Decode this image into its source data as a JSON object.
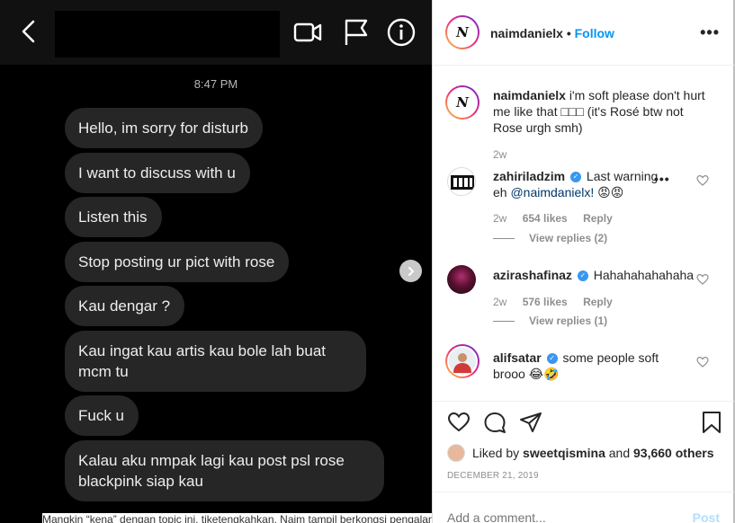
{
  "dm": {
    "time": "8:47 PM",
    "messages": [
      "Hello, im sorry for disturb",
      "I want to discuss with u",
      "Listen this",
      "Stop posting ur pict with rose",
      "Kau dengar ?",
      "Kau ingat kau artis kau bole lah buat mcm tu",
      "Fuck u",
      "Kalau aku nmpak lagi kau post psl rose blackpink siap kau"
    ],
    "caption_bleed": "Mangkin “kena” dengan topic ini, tiketengkahkan, Naim tampil berkongsi pengalamannya yang"
  },
  "post": {
    "username": "naimdanielx",
    "dot": "•",
    "follow_label": "Follow",
    "avatar_letter": "N",
    "caption_user": "naimdanielx",
    "caption_text": "i'm soft please don't hurt me like that □□□ (it's Rosé btw not Rose urgh smh)",
    "caption_age": "2w",
    "comments": [
      {
        "user": "zahiriladzim",
        "text_before": "Last warning eh",
        "mention": "@naimdanielx!",
        "emoji": "😡😡",
        "age": "2w",
        "likes": "654 likes",
        "reply": "Reply",
        "view_replies": "View replies (2)"
      },
      {
        "user": "azirashafinaz",
        "text": "Hahahahahahaha",
        "age": "2w",
        "likes": "576 likes",
        "reply": "Reply",
        "view_replies": "View replies (1)"
      },
      {
        "user": "alifsatar",
        "text": "some people soft brooo",
        "emoji": "😂🤣"
      }
    ],
    "likes_prefix": "Liked by",
    "likes_user": "sweetqismina",
    "likes_and": "and",
    "likes_others": "93,660 others",
    "date": "DECEMBER 21, 2019",
    "add_comment_placeholder": "Add a comment...",
    "post_button": "Post"
  },
  "colors": {
    "link_blue": "#0095f6",
    "verified_blue": "#3897f0",
    "bubble": "#262626"
  }
}
